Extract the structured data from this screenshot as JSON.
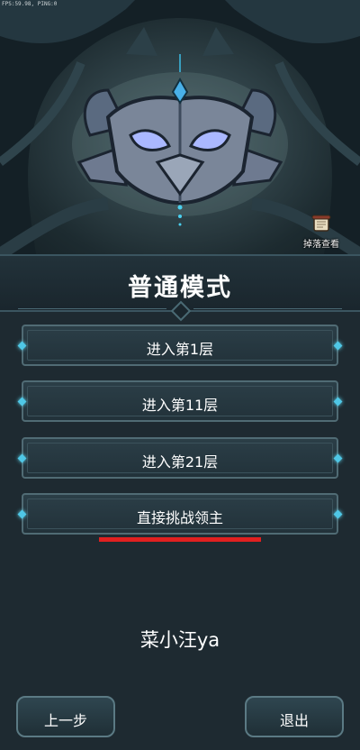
{
  "debug": {
    "fps_text": "FPS:59.98, PING:0"
  },
  "hero": {
    "boss_icon": "horned-demon-mask-emblem",
    "drop_button": {
      "label": "掉落查看",
      "icon": "scroll-icon"
    }
  },
  "mode": {
    "title": "普通模式"
  },
  "options": [
    {
      "label": "进入第1层"
    },
    {
      "label": "进入第11层"
    },
    {
      "label": "进入第21层"
    },
    {
      "label": "直接挑战领主"
    }
  ],
  "annotation": {
    "underline_color": "#e02020"
  },
  "player": {
    "name": "菜小汪ya"
  },
  "footer": {
    "back_label": "上一步",
    "exit_label": "退出"
  },
  "colors": {
    "accent_gem": "#4fc7e6",
    "panel": "#22323a",
    "border": "#506b74"
  }
}
